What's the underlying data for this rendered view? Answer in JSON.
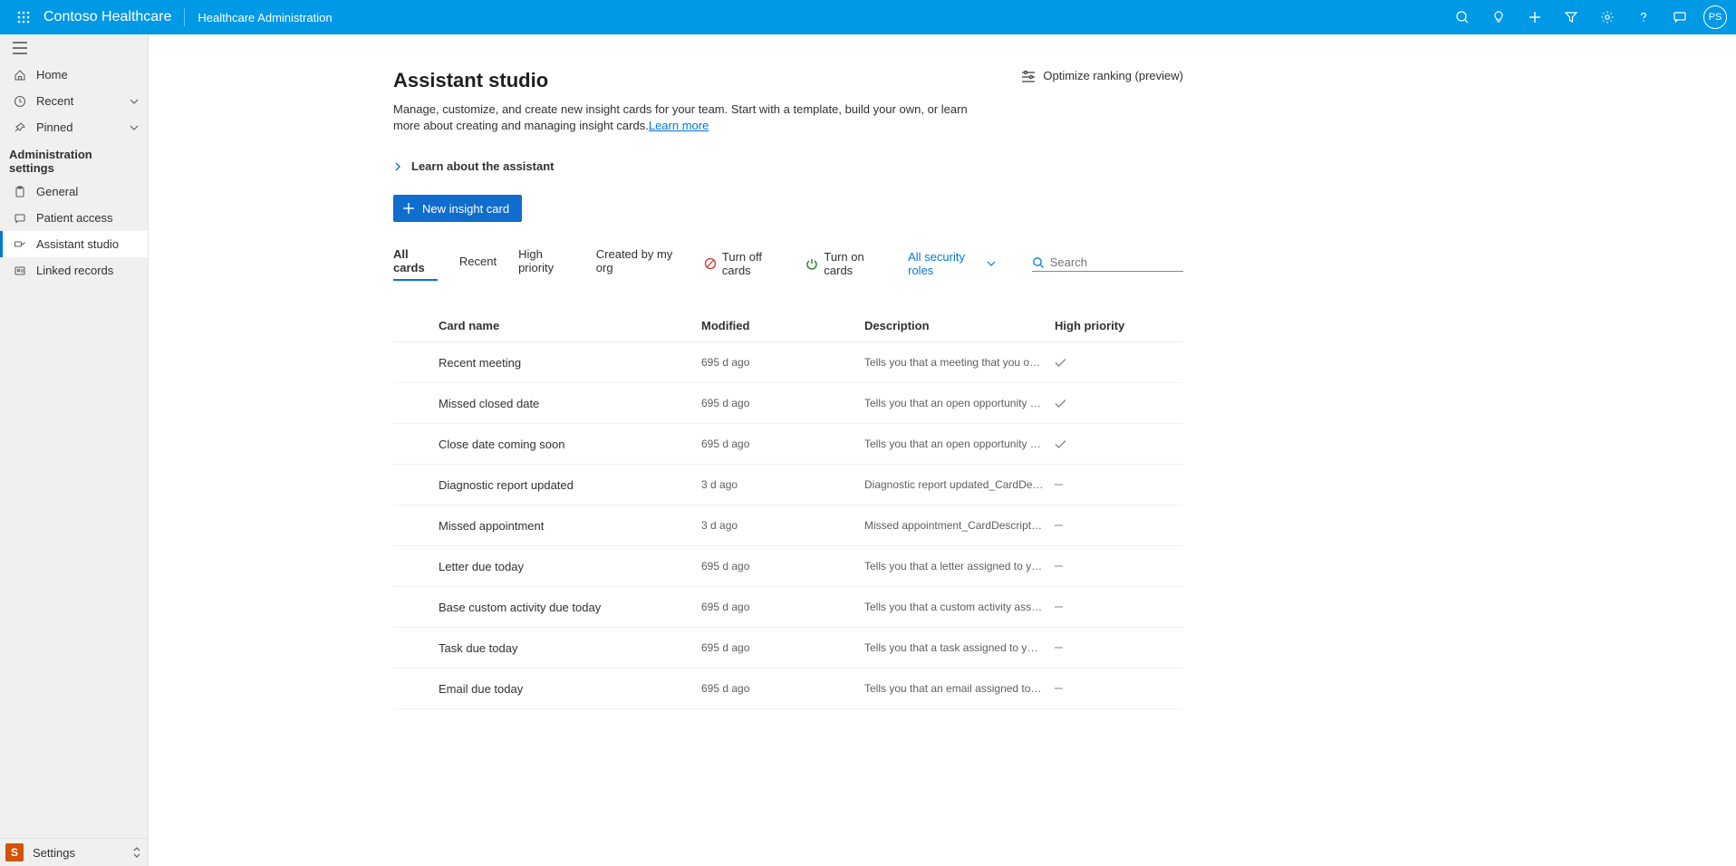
{
  "topbar": {
    "brand": "Contoso Healthcare",
    "subtitle": "Healthcare Administration",
    "avatar_initials": "PS"
  },
  "sidebar": {
    "home": "Home",
    "recent": "Recent",
    "pinned": "Pinned",
    "section_header": "Administration settings",
    "general": "General",
    "patient_access": "Patient access",
    "assistant_studio": "Assistant studio",
    "linked_records": "Linked records",
    "settings_badge": "S",
    "settings_label": "Settings"
  },
  "page": {
    "title": "Assistant studio",
    "description": "Manage, customize, and create new insight cards for your team. Start with a template, build your own, or learn more about creating and managing insight cards.",
    "learn_more": "Learn more",
    "optimize_label": "Optimize ranking (preview)",
    "learn_about": "Learn about the assistant",
    "new_card_btn": "New insight card"
  },
  "tabs": {
    "all_cards": "All cards",
    "recent": "Recent",
    "high_priority": "High priority",
    "created_by_org": "Created by my org",
    "turn_off": "Turn off cards",
    "turn_on": "Turn on cards",
    "roles_filter": "All security roles",
    "search_placeholder": "Search"
  },
  "table": {
    "headers": {
      "name": "Card name",
      "modified": "Modified",
      "description": "Description",
      "priority": "High priority"
    },
    "rows": [
      {
        "name": "Recent meeting",
        "modified": "695 d ago",
        "description": "Tells you that a meeting that you organize...",
        "priority": "check"
      },
      {
        "name": "Missed closed date",
        "modified": "695 d ago",
        "description": "Tells you that an open opportunity has pa...",
        "priority": "check"
      },
      {
        "name": "Close date coming soon",
        "modified": "695 d ago",
        "description": "Tells you that an open opportunity will so...",
        "priority": "check"
      },
      {
        "name": "Diagnostic report updated",
        "modified": "3 d ago",
        "description": "Diagnostic report updated_CardDescription",
        "priority": "minus"
      },
      {
        "name": "Missed appointment",
        "modified": "3 d ago",
        "description": "Missed appointment_CardDescription",
        "priority": "minus"
      },
      {
        "name": "Letter due today",
        "modified": "695 d ago",
        "description": "Tells you that a letter assigned to you is d...",
        "priority": "minus"
      },
      {
        "name": "Base custom activity due today",
        "modified": "695 d ago",
        "description": "Tells you that a custom activity assigned t...",
        "priority": "minus"
      },
      {
        "name": "Task due today",
        "modified": "695 d ago",
        "description": "Tells you that a task assigned to you is du...",
        "priority": "minus"
      },
      {
        "name": "Email due today",
        "modified": "695 d ago",
        "description": "Tells you that an email assigned to you is ...",
        "priority": "minus"
      }
    ]
  }
}
